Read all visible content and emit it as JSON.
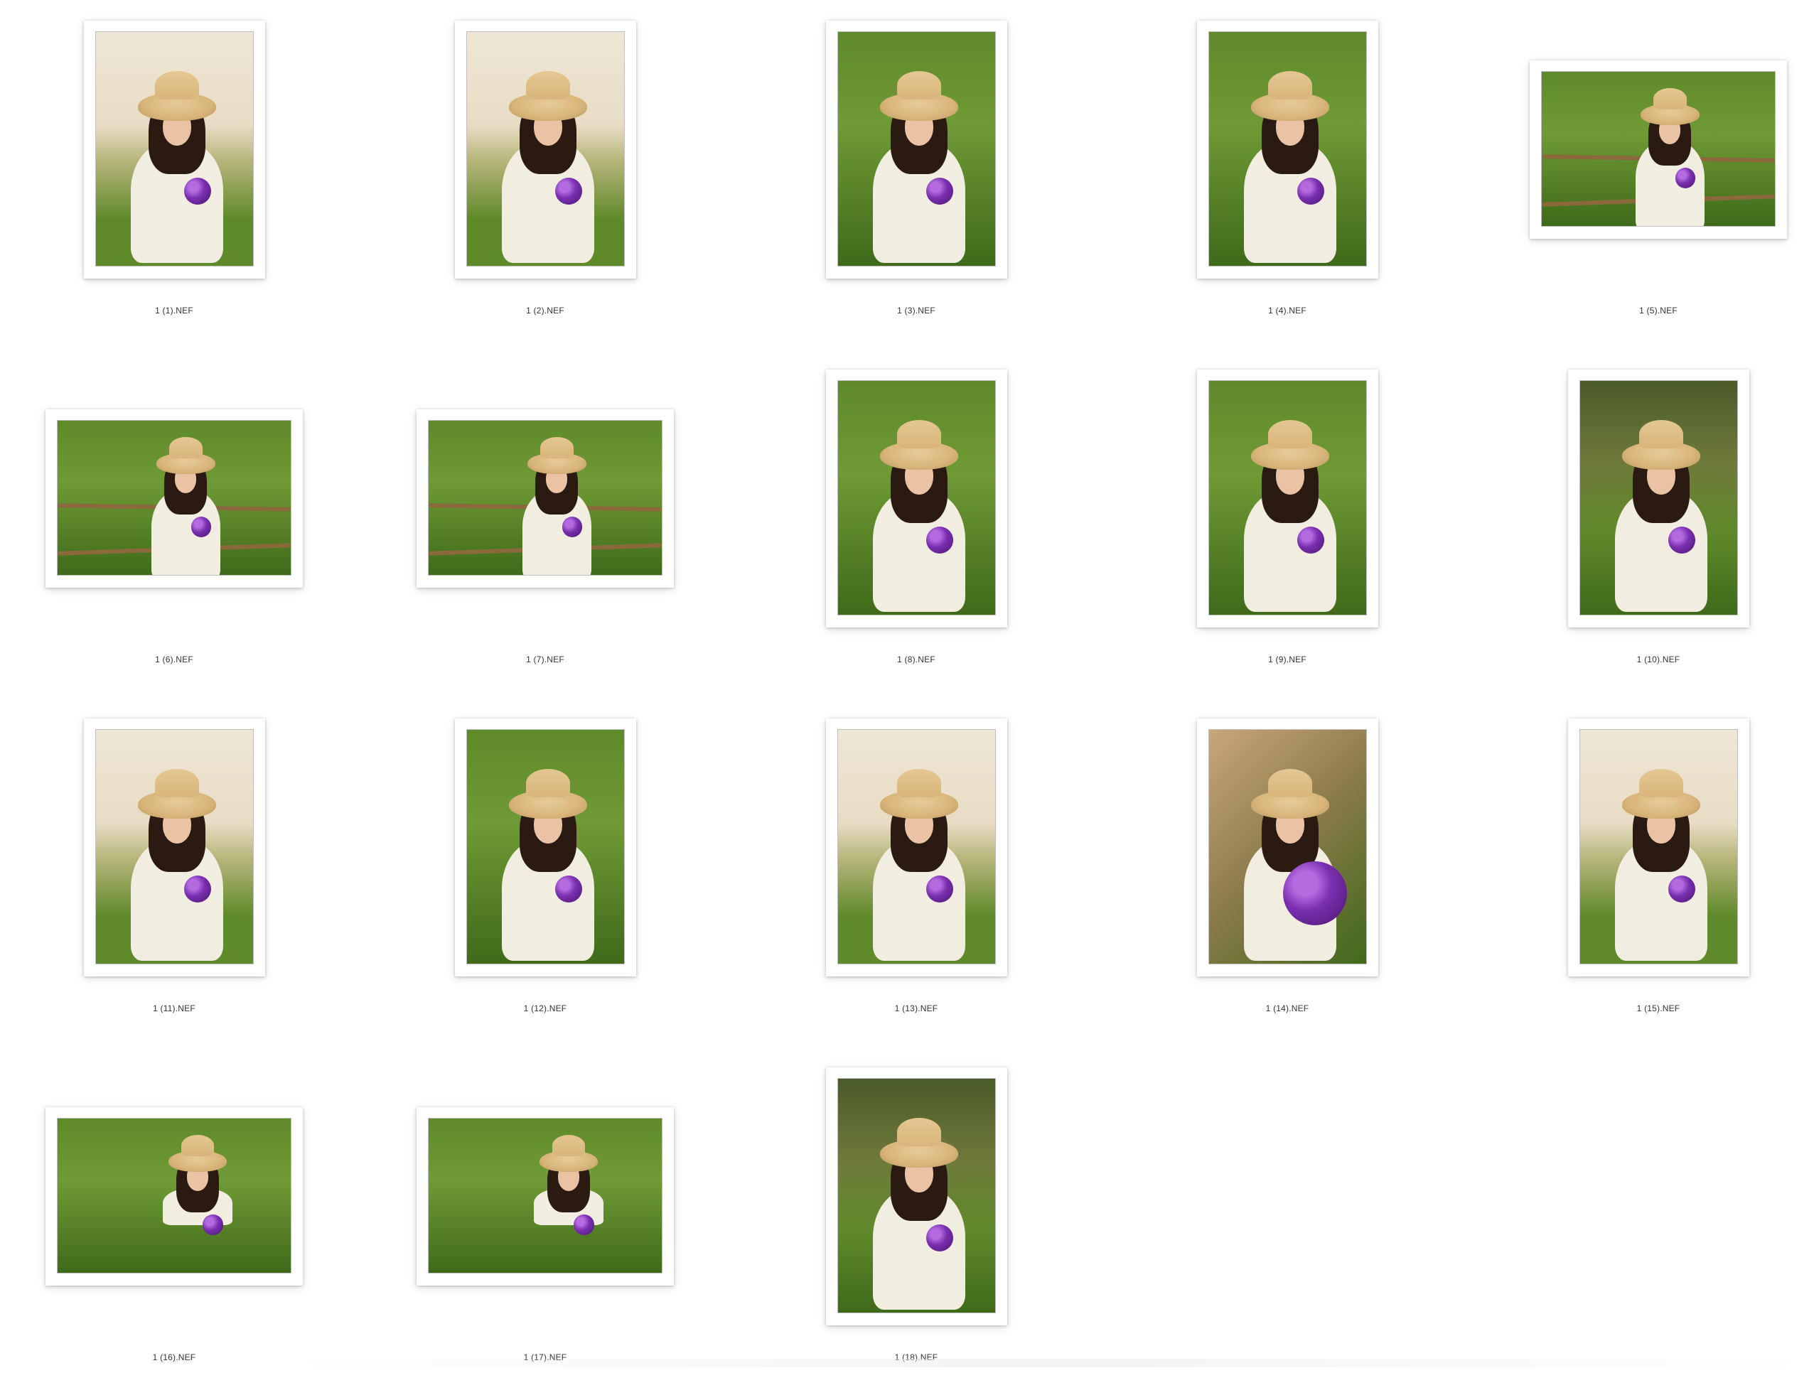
{
  "files": [
    {
      "name": "1 (1).NEF",
      "orientation": "portrait",
      "scene": "light"
    },
    {
      "name": "1 (2).NEF",
      "orientation": "portrait",
      "scene": "light"
    },
    {
      "name": "1 (3).NEF",
      "orientation": "portrait",
      "scene": "field"
    },
    {
      "name": "1 (4).NEF",
      "orientation": "portrait",
      "scene": "field"
    },
    {
      "name": "1 (5).NEF",
      "orientation": "landscape",
      "scene": "fence"
    },
    {
      "name": "1 (6).NEF",
      "orientation": "landscape",
      "scene": "fence"
    },
    {
      "name": "1 (7).NEF",
      "orientation": "landscape",
      "scene": "fence"
    },
    {
      "name": "1 (8).NEF",
      "orientation": "portrait",
      "scene": "field"
    },
    {
      "name": "1 (9).NEF",
      "orientation": "portrait",
      "scene": "field"
    },
    {
      "name": "1 (10).NEF",
      "orientation": "portrait",
      "scene": "trees"
    },
    {
      "name": "1 (11).NEF",
      "orientation": "portrait",
      "scene": "light"
    },
    {
      "name": "1 (12).NEF",
      "orientation": "portrait",
      "scene": "field"
    },
    {
      "name": "1 (13).NEF",
      "orientation": "portrait",
      "scene": "light"
    },
    {
      "name": "1 (14).NEF",
      "orientation": "portrait",
      "scene": "closeup"
    },
    {
      "name": "1 (15).NEF",
      "orientation": "portrait",
      "scene": "light"
    },
    {
      "name": "1 (16).NEF",
      "orientation": "landscape",
      "scene": "lying"
    },
    {
      "name": "1 (17).NEF",
      "orientation": "landscape",
      "scene": "lying"
    },
    {
      "name": "1 (18).NEF",
      "orientation": "portrait",
      "scene": "trees"
    }
  ],
  "colors": {
    "background": "#ffffff",
    "grass": "#5f8a2a",
    "grass_dark": "#3f6a1a",
    "sky_light": "#eee6d6",
    "hat": "#d8b57a",
    "dress": "#f2ede1",
    "flowers": "#7a2fb0"
  }
}
